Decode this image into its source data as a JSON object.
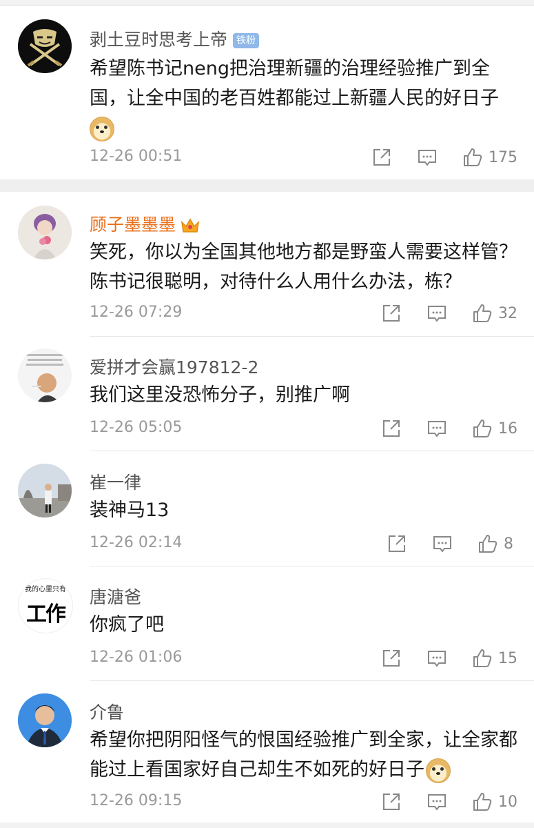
{
  "comments": [
    {
      "username": "剥土豆时思考上帝",
      "badge": "铁粉",
      "text": "希望陈书记neng把治理新疆的治理经验推广到全国，让全中国的老百姓都能过上新疆人民的好日子",
      "time": "12-26 00:51",
      "likes": "175"
    },
    {
      "username": "顾子墨墨墨",
      "text": "笑死，你以为全国其他地方都是野蛮人需要这样管？陈书记很聪明，对待什么人用什么办法，栋？",
      "time": "12-26 07:29",
      "likes": "32"
    },
    {
      "username": "爱拼才会赢197812-2",
      "text": "我们这里没恐怖分子，别推广啊",
      "time": "12-26 05:05",
      "likes": "16"
    },
    {
      "username": "崔一律",
      "text": "装神马13",
      "time": "12-26 02:14",
      "likes": "8"
    },
    {
      "username": "唐溏爸",
      "text": "你疯了吧",
      "time": "12-26 01:06",
      "likes": "15"
    },
    {
      "username": "介鲁",
      "text": "希望你把阴阳怪气的恨国经验推广到全家，让全家都能过上看国家好自己却生不如死的好日子",
      "time": "12-26 09:15",
      "likes": "10"
    }
  ],
  "avatar_texts": {
    "c5": "我的心里只有",
    "c5_big": "工作"
  },
  "icons": {
    "share": "share-icon",
    "reply": "comment-icon",
    "like": "thumbs-up-icon"
  },
  "colors": {
    "vip_name": "#ea6f1a",
    "fans_badge": "#8fb8e8",
    "meta": "#999999"
  }
}
